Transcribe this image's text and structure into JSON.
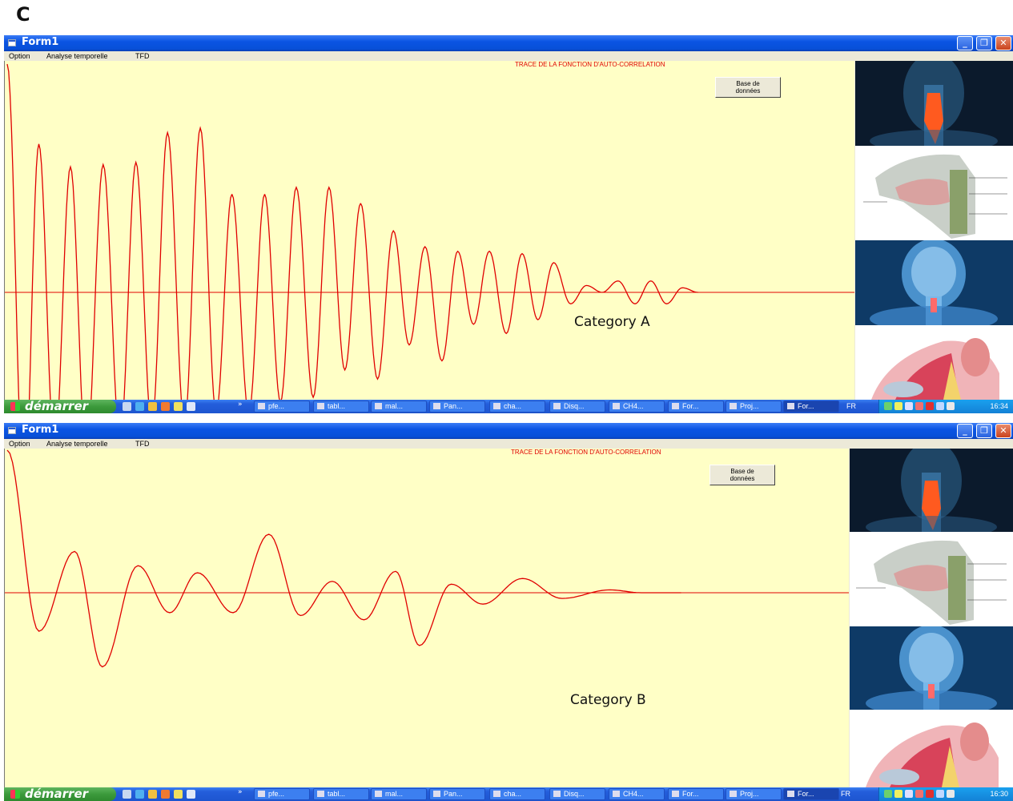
{
  "figure_label": "C",
  "screenshots": [
    {
      "window_title": "Form1",
      "menu": [
        "Option",
        "Analyse temporelle",
        "TFD"
      ],
      "plot_title": "TRACE DE LA FONCTION D'AUTO-CORRELATION",
      "db_button": "Base de\ndonnées",
      "category_label": "Category A",
      "taskbar": {
        "start": "démarrer",
        "tasks": [
          "pfe...",
          "tabl...",
          "mal...",
          "Pan...",
          "cha...",
          "Disq...",
          "CH4...",
          "For...",
          "Proj...",
          "For..."
        ],
        "active_task": 9,
        "lang": "FR",
        "clock": "16:34"
      }
    },
    {
      "window_title": "Form1",
      "menu": [
        "Option",
        "Analyse temporelle",
        "TFD"
      ],
      "plot_title": "TRACE DE LA FONCTION D'AUTO-CORRELATION",
      "db_button": "Base de\ndonnées",
      "category_label": "Category B",
      "taskbar": {
        "start": "démarrer",
        "tasks": [
          "pfe...",
          "tabl...",
          "mal...",
          "Pan...",
          "cha...",
          "Disq...",
          "CH4...",
          "For...",
          "Proj...",
          "For..."
        ],
        "active_task": 9,
        "lang": "FR",
        "clock": "16:30"
      }
    }
  ],
  "side_image_icons": [
    "throat-xray-icon",
    "pharynx-diagram-icon",
    "head-skeleton-icon",
    "ear-throat-anatomy-icon"
  ],
  "chart_data": [
    {
      "type": "line",
      "series_color": "#e00000",
      "x_range": [
        0,
        600
      ],
      "y_range": [
        -1,
        1
      ],
      "peaks": [
        [
          0,
          1.0
        ],
        [
          15,
          -0.9
        ],
        [
          28,
          0.65
        ],
        [
          42,
          -0.7
        ],
        [
          56,
          0.55
        ],
        [
          70,
          -0.72
        ],
        [
          85,
          0.56
        ],
        [
          100,
          -0.65
        ],
        [
          114,
          0.57
        ],
        [
          128,
          -0.59
        ],
        [
          142,
          0.7
        ],
        [
          157,
          -0.58
        ],
        [
          171,
          0.72
        ],
        [
          185,
          -0.53
        ],
        [
          199,
          0.43
        ],
        [
          214,
          -0.53
        ],
        [
          228,
          0.43
        ],
        [
          242,
          -0.48
        ],
        [
          256,
          0.46
        ],
        [
          271,
          -0.46
        ],
        [
          285,
          0.46
        ],
        [
          299,
          -0.34
        ],
        [
          313,
          0.39
        ],
        [
          328,
          -0.38
        ],
        [
          342,
          0.27
        ],
        [
          356,
          -0.23
        ],
        [
          370,
          0.2
        ],
        [
          385,
          -0.3
        ],
        [
          399,
          0.18
        ],
        [
          413,
          -0.14
        ],
        [
          427,
          0.18
        ],
        [
          442,
          -0.18
        ],
        [
          456,
          0.17
        ],
        [
          470,
          -0.12
        ],
        [
          484,
          0.13
        ],
        [
          499,
          -0.05
        ],
        [
          513,
          0.03
        ],
        [
          527,
          0.0
        ],
        [
          541,
          0.05
        ],
        [
          556,
          -0.05
        ],
        [
          570,
          0.05
        ],
        [
          584,
          -0.05
        ],
        [
          598,
          0.02
        ],
        [
          612,
          0.0
        ]
      ]
    },
    {
      "type": "line",
      "series_color": "#e00000",
      "x_range": [
        0,
        600
      ],
      "y_range": [
        -1,
        1
      ],
      "peaks": [
        [
          0,
          1.0
        ],
        [
          40,
          -0.27
        ],
        [
          85,
          0.29
        ],
        [
          120,
          -0.52
        ],
        [
          165,
          0.19
        ],
        [
          205,
          -0.14
        ],
        [
          240,
          0.14
        ],
        [
          285,
          -0.14
        ],
        [
          330,
          0.41
        ],
        [
          370,
          -0.16
        ],
        [
          410,
          0.08
        ],
        [
          450,
          -0.19
        ],
        [
          490,
          0.15
        ],
        [
          520,
          -0.37
        ],
        [
          560,
          0.06
        ],
        [
          600,
          -0.08
        ],
        [
          650,
          0.1
        ],
        [
          700,
          -0.04
        ],
        [
          760,
          0.02
        ],
        [
          800,
          0.0
        ],
        [
          850,
          0.0
        ]
      ]
    }
  ]
}
